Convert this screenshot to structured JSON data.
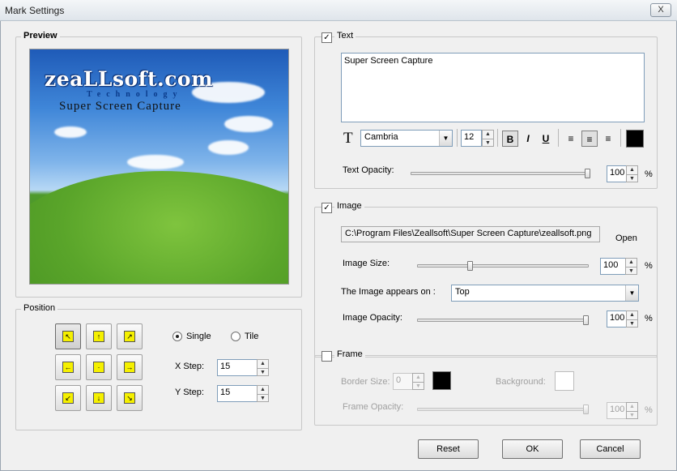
{
  "window": {
    "title": "Mark Settings",
    "close_glyph": "X"
  },
  "preview": {
    "label": "Preview",
    "logo_text": "zeaLLsoft.com",
    "logo_subtext": "Technology",
    "caption_text": "Super Screen Capture"
  },
  "position": {
    "label": "Position",
    "single_label": "Single",
    "tile_label": "Tile",
    "mode": "Single",
    "xstep_label": "X Step:",
    "xstep_value": "15",
    "ystep_label": "Y Step:",
    "ystep_value": "15",
    "grid_icons": [
      "arrow-up-left-icon",
      "arrow-up-icon",
      "arrow-up-right-icon",
      "arrow-left-icon",
      "center-dot-icon",
      "arrow-right-icon",
      "arrow-down-left-icon",
      "arrow-down-icon",
      "arrow-down-right-icon"
    ],
    "selected": "arrow-up-left-icon"
  },
  "text_section": {
    "label": "Text",
    "checked": true,
    "content": "Super Screen Capture",
    "font_name": "Cambria",
    "font_size": "12",
    "bold_label": "B",
    "italic_label": "I",
    "underline_label": "U",
    "font_icon": "T",
    "opacity_label": "Text Opacity:",
    "opacity_value": "100",
    "percent": "%",
    "color": "#000000",
    "opacity_level": 1.0
  },
  "image_section": {
    "label": "Image",
    "checked": true,
    "path": "C:\\Program Files\\Zeallsoft\\Super Screen Capture\\zeallsoft.png",
    "open_label": "Open",
    "size_label": "Image Size:",
    "size_value": "100",
    "appears_label": "The Image appears  on :",
    "appears_value": "Top",
    "opacity_label": "Image Opacity:",
    "opacity_value": "100",
    "percent": "%",
    "size_level": 0.3,
    "opacity_level": 1.0
  },
  "frame_section": {
    "label": "Frame",
    "checked": false,
    "border_label": "Border Size:",
    "border_value": "0",
    "border_color": "#000000",
    "background_label": "Background:",
    "background_color": "#ffffff",
    "opacity_label": "Frame Opacity:",
    "opacity_value": "100",
    "percent": "%",
    "opacity_level": 1.0
  },
  "buttons": {
    "reset": "Reset",
    "ok": "OK",
    "cancel": "Cancel"
  }
}
